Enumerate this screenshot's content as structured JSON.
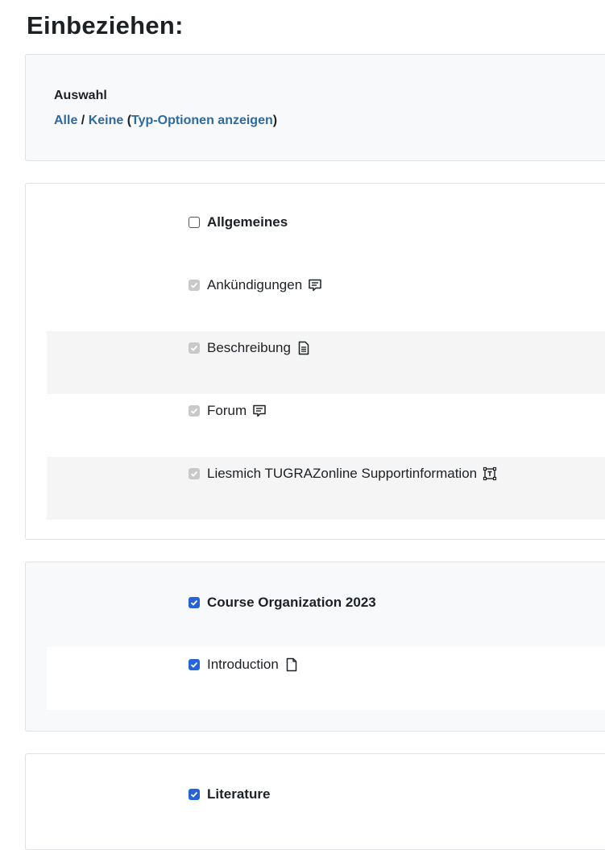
{
  "title": "Einbeziehen:",
  "selection": {
    "label": "Auswahl",
    "all": "Alle",
    "separator": " / ",
    "none": "Keine",
    "paren_open": " (",
    "type_options": "Typ-Optionen anzeigen",
    "paren_close": ")"
  },
  "sections": [
    {
      "name": "Allgemeines",
      "checked": false,
      "items": [
        {
          "label": "Ankündigungen",
          "icon": "forum-icon",
          "state": "disabled-checked"
        },
        {
          "label": "Beschreibung",
          "icon": "page-icon",
          "state": "disabled-checked"
        },
        {
          "label": "Forum",
          "icon": "forum-icon",
          "state": "disabled-checked"
        },
        {
          "label": "Liesmich TUGRAZonline Supportinformation",
          "icon": "label-icon",
          "state": "disabled-checked"
        }
      ]
    },
    {
      "name": "Course Organization 2023",
      "checked": true,
      "items": [
        {
          "label": "Introduction",
          "icon": "file-icon",
          "state": "checked"
        }
      ]
    },
    {
      "name": "Literature",
      "checked": true,
      "items": []
    }
  ],
  "colors": {
    "link": "#2f6a9c",
    "checkbox_checked": "#2563d6",
    "checkbox_disabled": "#c9c9c9"
  }
}
